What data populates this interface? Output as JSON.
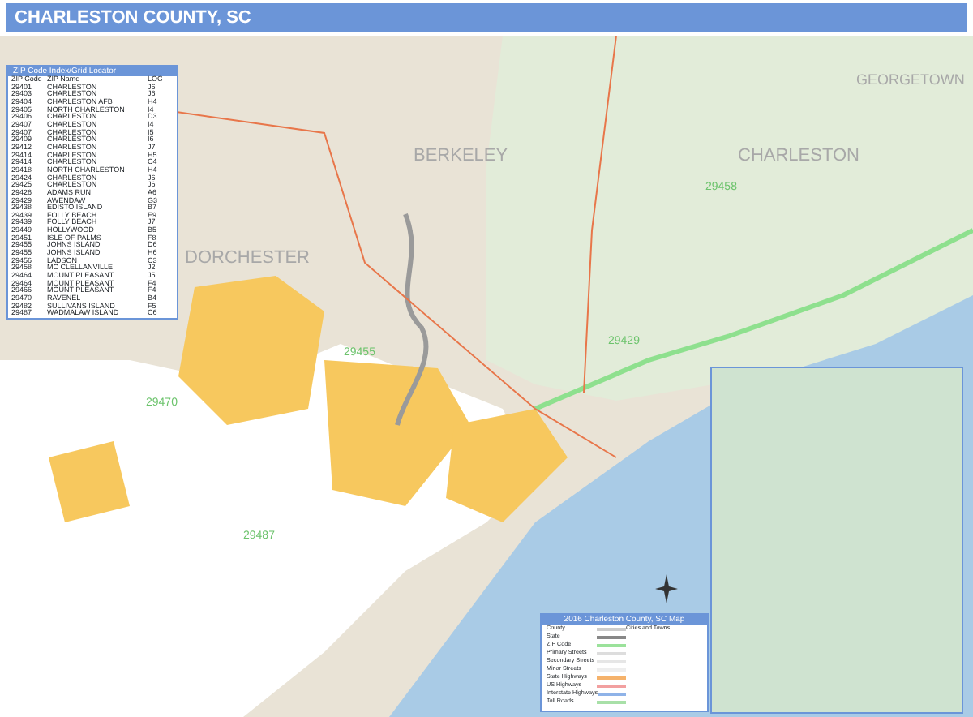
{
  "header": {
    "title": "CHARLESTON COUNTY, SC"
  },
  "map": {
    "labels": [
      {
        "text": "BERKELEY",
        "kind": "county"
      },
      {
        "text": "CHARLESTON",
        "kind": "county"
      },
      {
        "text": "DORCHESTER",
        "kind": "county"
      },
      {
        "text": "GEORGETOWN",
        "kind": "county"
      },
      {
        "text": "29458",
        "kind": "zip"
      },
      {
        "text": "29429",
        "kind": "zip"
      },
      {
        "text": "29455",
        "kind": "zip"
      },
      {
        "text": "29470",
        "kind": "zip"
      },
      {
        "text": "29487",
        "kind": "zip"
      }
    ]
  },
  "zip_table": {
    "title": "ZIP Code Index/Grid Locator",
    "columns": [
      "ZIP Code",
      "ZIP Name",
      "LOC"
    ],
    "rows": [
      [
        "29401",
        "CHARLESTON",
        "J6"
      ],
      [
        "29403",
        "CHARLESTON",
        "J6"
      ],
      [
        "29404",
        "CHARLESTON AFB",
        "H4"
      ],
      [
        "29405",
        "NORTH CHARLESTON",
        "I4"
      ],
      [
        "29406",
        "CHARLESTON",
        "D3"
      ],
      [
        "29407",
        "CHARLESTON",
        "I4"
      ],
      [
        "29407",
        "CHARLESTON",
        "I5"
      ],
      [
        "29409",
        "CHARLESTON",
        "I6"
      ],
      [
        "29412",
        "CHARLESTON",
        "J7"
      ],
      [
        "29414",
        "CHARLESTON",
        "H5"
      ],
      [
        "29414",
        "CHARLESTON",
        "C4"
      ],
      [
        "29418",
        "NORTH CHARLESTON",
        "H4"
      ],
      [
        "29424",
        "CHARLESTON",
        "J6"
      ],
      [
        "29425",
        "CHARLESTON",
        "J6"
      ],
      [
        "29426",
        "ADAMS RUN",
        "A6"
      ],
      [
        "29429",
        "AWENDAW",
        "G3"
      ],
      [
        "29438",
        "EDISTO ISLAND",
        "B7"
      ],
      [
        "29439",
        "FOLLY BEACH",
        "E9"
      ],
      [
        "29439",
        "FOLLY BEACH",
        "J7"
      ],
      [
        "29449",
        "HOLLYWOOD",
        "B5"
      ],
      [
        "29451",
        "ISLE OF PALMS",
        "F8"
      ],
      [
        "29455",
        "JOHNS ISLAND",
        "D6"
      ],
      [
        "29455",
        "JOHNS ISLAND",
        "H6"
      ],
      [
        "29456",
        "LADSON",
        "C3"
      ],
      [
        "29458",
        "MC CLELLANVILLE",
        "J2"
      ],
      [
        "29464",
        "MOUNT PLEASANT",
        "J5"
      ],
      [
        "29464",
        "MOUNT PLEASANT",
        "F4"
      ],
      [
        "29466",
        "MOUNT PLEASANT",
        "F4"
      ],
      [
        "29470",
        "RAVENEL",
        "B4"
      ],
      [
        "29482",
        "SULLIVANS ISLAND",
        "F5"
      ],
      [
        "29487",
        "WADMALAW ISLAND",
        "C6"
      ]
    ]
  },
  "legend": {
    "title": "2016 Charleston County, SC Map",
    "section": "Cities and Towns",
    "items": [
      {
        "label": "County",
        "color": "#cccccc"
      },
      {
        "label": "State",
        "color": "#888888"
      },
      {
        "label": "ZIP Code",
        "color": "#9be29b"
      },
      {
        "label": "Primary Streets",
        "color": "#dddddd"
      },
      {
        "label": "Secondary Streets",
        "color": "#e6e6e6"
      },
      {
        "label": "Minor Streets",
        "color": "#eeeeee"
      },
      {
        "label": "State Highways",
        "color": "#f5b26b"
      },
      {
        "label": "US Highways",
        "color": "#f2a0a0"
      },
      {
        "label": "Interstate Highways",
        "color": "#8fb3e8"
      },
      {
        "label": "Toll Roads",
        "color": "#a8e0a8"
      }
    ]
  }
}
